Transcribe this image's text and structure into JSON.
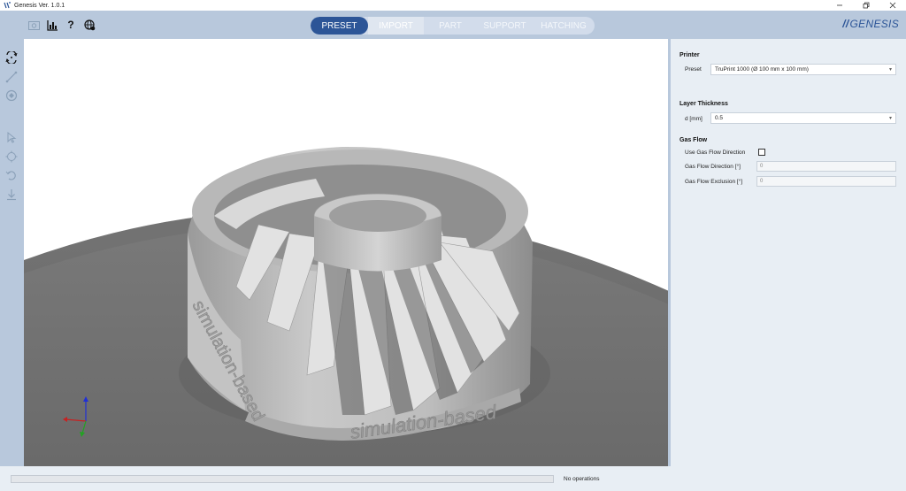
{
  "window": {
    "title": "Genesis Ver. 1.0.1",
    "controls": [
      "minimize-icon",
      "restore-icon",
      "close-icon"
    ]
  },
  "toolbar": {
    "icons": [
      "screenshot-icon",
      "chart-icon",
      "help-icon",
      "globe-settings-icon"
    ],
    "help_label": "?",
    "tabs": [
      {
        "label": "PRESET",
        "state": "active"
      },
      {
        "label": "IMPORT",
        "state": "next"
      },
      {
        "label": "PART",
        "state": "disabled"
      },
      {
        "label": "SUPPORT",
        "state": "disabled"
      },
      {
        "label": "HATCHING",
        "state": "disabled"
      }
    ],
    "brand": "GENESIS",
    "brand_slashes": "//"
  },
  "left_tools": [
    "rotate-view-icon",
    "measure-icon",
    "face-select-icon",
    "pointer-icon",
    "move-icon",
    "rotate-icon",
    "drop-icon"
  ],
  "viewport": {
    "model_text_side": "simulation-based",
    "model_text_front": "simulation-based"
  },
  "panel": {
    "printer": {
      "section": "Printer",
      "preset_label": "Preset",
      "preset_value": "TruPrint 1000 (Ø 100 mm x 100 mm)"
    },
    "layer": {
      "section": "Layer Thickness",
      "d_label": "d [mm]",
      "d_value": "0.5"
    },
    "gas": {
      "section": "Gas Flow",
      "use_label": "Use Gas Flow Direction",
      "use_checked": false,
      "direction_label": "Gas Flow Direction [°]",
      "direction_value": "0",
      "exclusion_label": "Gas Flow Exclusion [°]",
      "exclusion_value": "0"
    }
  },
  "status": {
    "text": "No operations",
    "progress": 0
  },
  "colors": {
    "accent": "#2c5597",
    "toolbar": "#b8c8dc",
    "panel": "#e8eef4"
  }
}
